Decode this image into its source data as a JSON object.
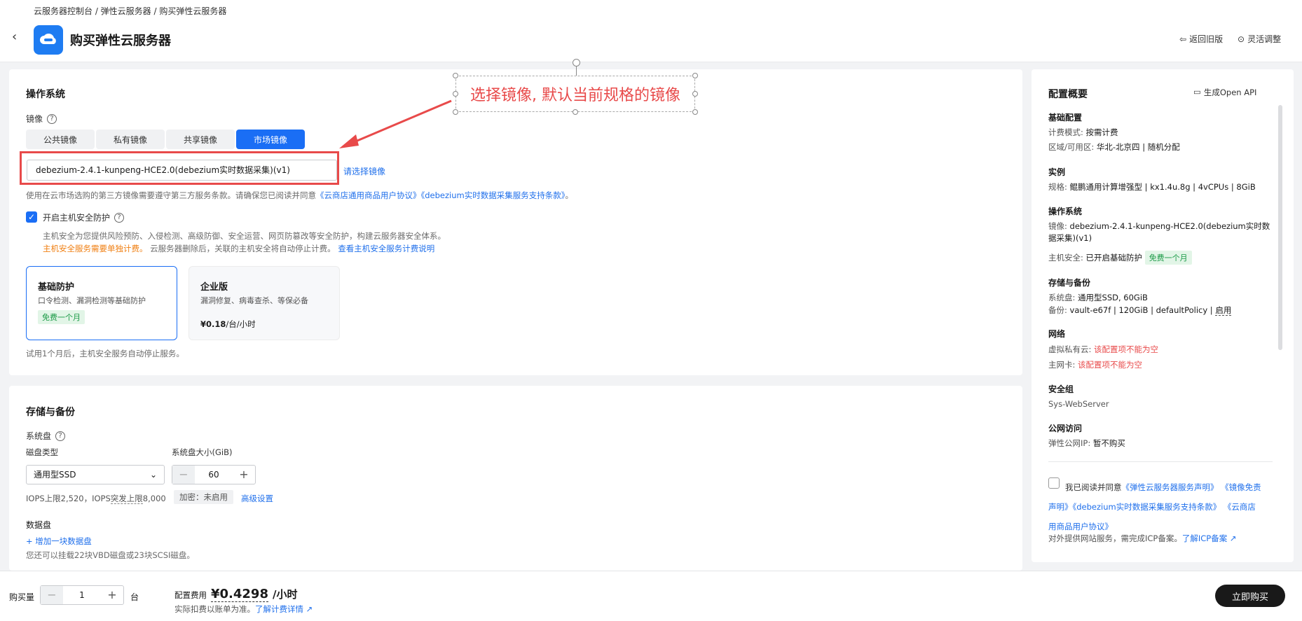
{
  "breadcrumb": "云服务器控制台 / 弹性云服务器 / 购买弹性云服务器",
  "page_title": "购买弹性云服务器",
  "header_links": {
    "back_old": "返回旧版",
    "flex_adjust": "灵活调整"
  },
  "os_section": {
    "title": "操作系统",
    "image_label": "镜像",
    "tabs": [
      "公共镜像",
      "私有镜像",
      "共享镜像",
      "市场镜像"
    ],
    "active_tab": "市场镜像",
    "image_value": "debezium-2.4.1-kunpeng-HCE2.0(debezium实时数据采集)(v1)",
    "reselect_link": "请选择镜像",
    "notice_prefix": "使用在云市场选购的第三方镜像需要遵守第三方服务条款。请确保您已阅读并同意",
    "notice_link1": "《云商店通用商品用户协议》",
    "notice_link2": "《debezium实时数据采集服务支持条款》",
    "notice_suffix": "。",
    "host_security_label": "开启主机安全防护",
    "host_security_desc": "主机安全为您提供风险预防、入侵检测、高级防御、安全运营、网页防篡改等安全防护，构建云服务器安全体系。",
    "billing_note_orange": "主机安全服务需要单独计费。",
    "billing_note_rest": "云服务器删除后，关联的主机安全将自动停止计费。",
    "billing_link": "查看主机安全服务计费说明",
    "plan_basic": {
      "title": "基础防护",
      "desc": "口令检测、漏洞检测等基础防护",
      "badge": "免费一个月"
    },
    "plan_enterprise": {
      "title": "企业版",
      "desc": "漏洞修复、病毒查杀、等保必备",
      "price": "¥0.18",
      "unit": "/台/小时"
    },
    "trial_note": "试用1个月后，主机安全服务自动停止服务。"
  },
  "annotation": {
    "text": "选择镜像, 默认当前规格的镜像"
  },
  "storage_section": {
    "title": "存储与备份",
    "system_disk_label": "系统盘",
    "disk_type_label": "磁盘类型",
    "disk_type_value": "通用型SSD",
    "disk_size_label": "系统盘大小(GiB)",
    "disk_size_value": "60",
    "iops_text_prefix": "IOPS上限2,520，IOPS",
    "iops_text_burst": "突发上限",
    "iops_text_suffix": "8,000",
    "encrypt_tag": "加密：未启用",
    "advanced_link": "高级设置",
    "data_disk_label": "数据盘",
    "add_disk_link": "+ 增加一块数据盘",
    "data_disk_note": "您还可以挂载22块VBD磁盘或23块SCSI磁盘。"
  },
  "summary": {
    "title": "配置概要",
    "open_api": "生成Open API",
    "basic": {
      "title": "基础配置",
      "billing_label": "计费模式:",
      "billing_value": "按需计费",
      "region_label": "区域/可用区:",
      "region_value": "华北-北京四 | 随机分配"
    },
    "instance": {
      "title": "实例",
      "spec_label": "规格:",
      "spec_value": "鲲鹏通用计算增强型 | kx1.4u.8g | 4vCPUs | 8GiB"
    },
    "os": {
      "title": "操作系统",
      "image_label": "镜像:",
      "image_value_line1": "debezium-2.4.1-kunpeng-HCE2.0(debezium实时数",
      "image_value_line2": "据采集)(v1)",
      "security_label": "主机安全:",
      "security_value": "已开启基础防护",
      "security_badge": "免费一个月"
    },
    "storage": {
      "title": "存储与备份",
      "system_label": "系统盘:",
      "system_value": "通用型SSD, 60GiB",
      "backup_label": "备份:",
      "backup_value": "vault-e67f | 120GiB | defaultPolicy |",
      "backup_status": "启用"
    },
    "network": {
      "title": "网络",
      "vpc_label": "虚拟私有云:",
      "vpc_error": "该配置项不能为空",
      "nic_label": "主网卡:",
      "nic_error": "该配置项不能为空"
    },
    "security_group": {
      "title": "安全组",
      "value": "Sys-WebServer"
    },
    "public": {
      "title": "公网访问",
      "eip_label": "弹性公网IP:",
      "eip_value": "暂不购买"
    },
    "agree_prefix": "我已阅读并同意",
    "agree_link1": "《弹性云服务器服务声明》",
    "agree_link2a": "《镜像免责",
    "agree_link2b": "声明》",
    "agree_link3": "《debezium实时数据采集服务支持条款》",
    "agree_link4a": "《云商店",
    "agree_link4b": "用商品用户协议》",
    "icp_text": "对外提供网站服务，需完成ICP备案。",
    "icp_link": "了解ICP备案"
  },
  "footer": {
    "qty_label": "购买量",
    "qty_value": "1",
    "qty_unit": "台",
    "fee_label": "配置费用",
    "fee_value": "¥0.4298",
    "fee_unit": "/小时",
    "fee_note": "实际扣费以账单为准。",
    "fee_link": "了解计费详情",
    "buy_button": "立即购买"
  },
  "colors": {
    "primary": "#1a6ef5",
    "highlight": "#e84a4a",
    "warning": "#f07f12",
    "success": "#1a9a46"
  }
}
